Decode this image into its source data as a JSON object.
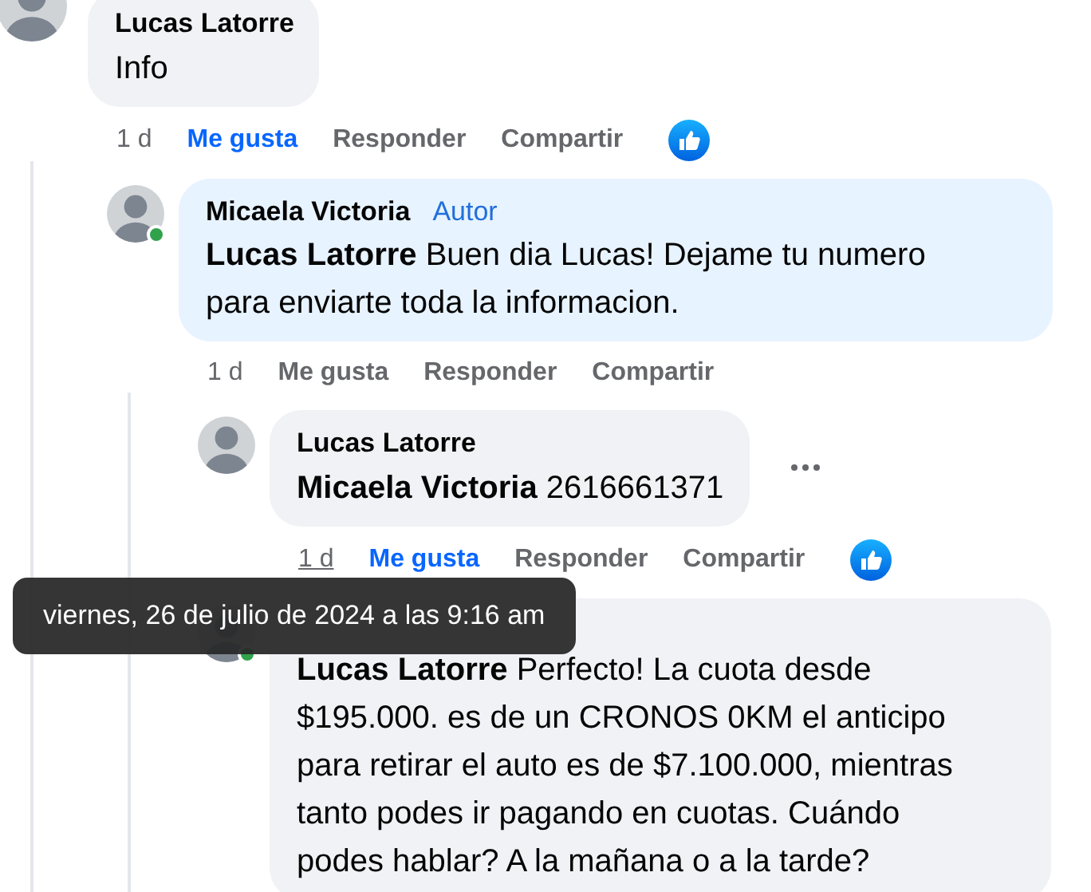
{
  "comments": [
    {
      "author": "Lucas Latorre",
      "text": "Info",
      "color": "#f0f2f5",
      "time": "1 d",
      "time_hovered": false,
      "reacted": true,
      "actions": [
        {
          "label": "Me gusta",
          "selected": true
        },
        {
          "label": "Responder",
          "selected": false
        },
        {
          "label": "Compartir",
          "selected": false
        }
      ],
      "children": [
        {
          "author": "Micaela Victoria",
          "badge": "Autor",
          "mention": "Lucas Latorre",
          "text": "Buen dia Lucas! Dejame tu numero para enviarte toda la informacion.",
          "online": true,
          "color": "#e7f3ff",
          "time": "1 d",
          "time_hovered": false,
          "actions": [
            {
              "label": "Me gusta",
              "selected": false
            },
            {
              "label": "Responder",
              "selected": false
            },
            {
              "label": "Compartir",
              "selected": false
            }
          ],
          "children": [
            {
              "author": "Lucas Latorre",
              "mention": "Micaela Victoria",
              "text": "2616661371",
              "color": "#f0f2f5",
              "time": "1 d",
              "time_hovered": true,
              "reacted": true,
              "more_menu": true,
              "actions": [
                {
                  "label": "Me gusta",
                  "selected": true
                },
                {
                  "label": "Responder",
                  "selected": false
                },
                {
                  "label": "Compartir",
                  "selected": false
                }
              ]
            },
            {
              "mention": "Lucas Latorre",
              "text": "Perfecto! La cuota desde $195.000. es de un CRONOS 0KM el anticipo para retirar el auto es de $7.100.000, mientras tanto podes ir pagando en cuotas. Cuándo podes hablar? A la mañana o a la tarde?",
              "online": true,
              "color": "#f0f2f5"
            }
          ]
        }
      ]
    }
  ],
  "tooltip": {
    "text": "viernes, 26 de julio de 2024 a las 9:16 am"
  }
}
